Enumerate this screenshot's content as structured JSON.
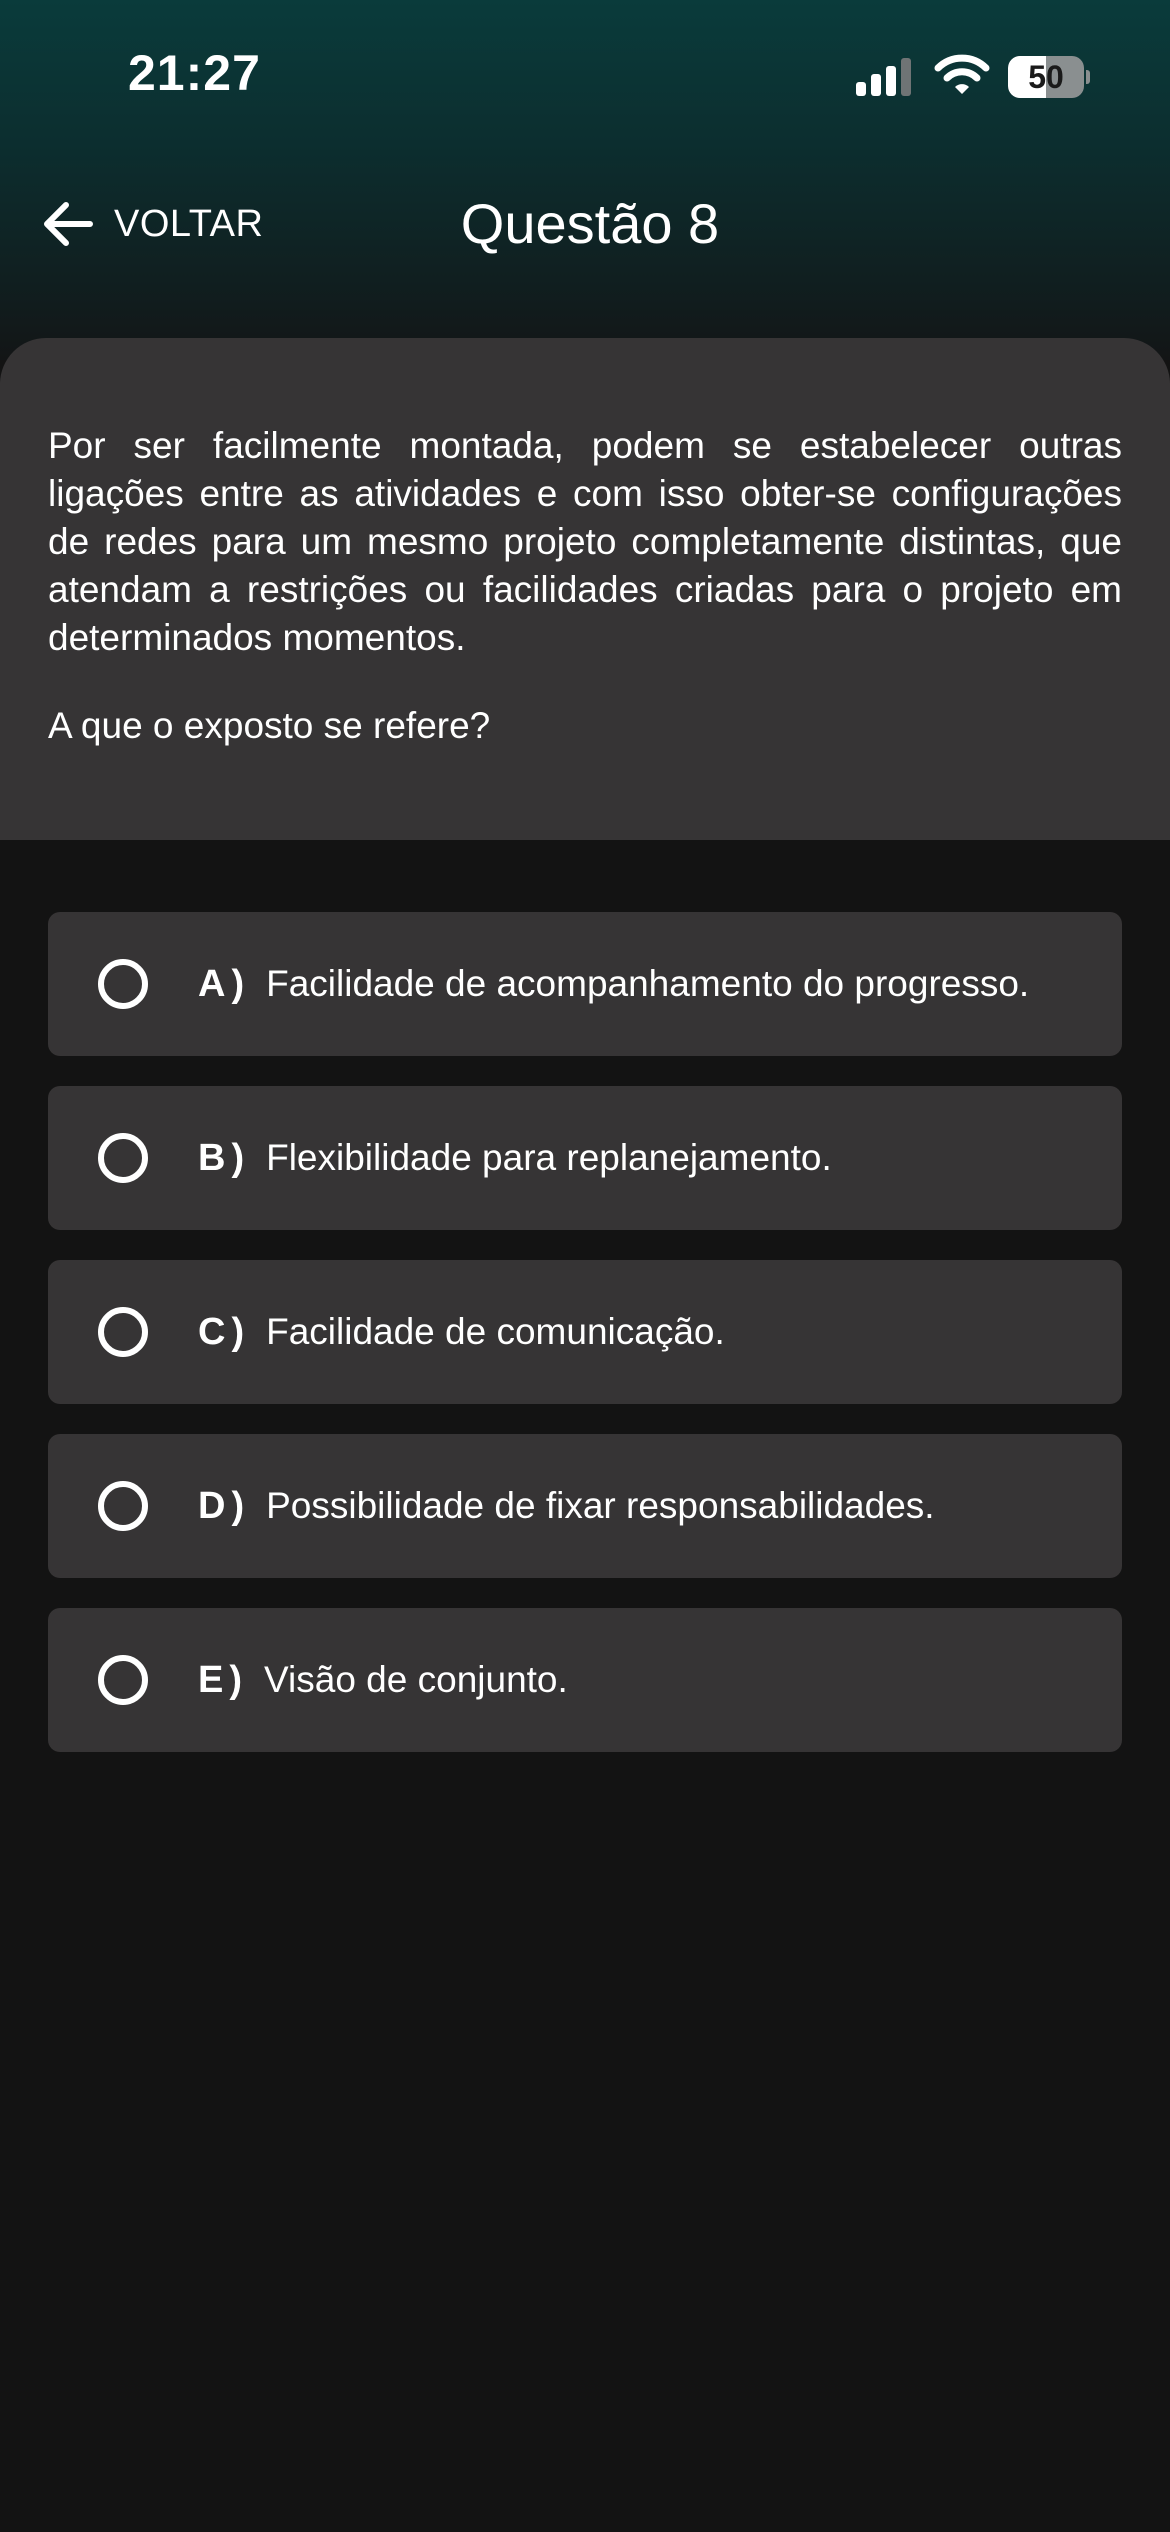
{
  "status_bar": {
    "time": "21:27",
    "battery": "50",
    "battery_level": 0.5,
    "icons": [
      "cellular-signal-icon",
      "wifi-icon",
      "battery-icon"
    ]
  },
  "nav": {
    "back_label": "VOLTAR",
    "title": "Questão 8"
  },
  "question": {
    "text": "Por ser facilmente montada, podem se estabelecer outras ligações entre as atividades e com isso obter-se configurações de redes para um mesmo projeto completamente distintas, que atendam a restrições ou facilidades criadas para o projeto em determinados momentos.",
    "prompt": "A que o exposto se refere?"
  },
  "options": [
    {
      "letter": "A",
      "paren": ")",
      "text": "Facilidade de acompanhamento do progresso."
    },
    {
      "letter": "B",
      "paren": ")",
      "text": "Flexibilidade para replanejamento."
    },
    {
      "letter": "C",
      "paren": ")",
      "text": "Facilidade de comunicação."
    },
    {
      "letter": "D",
      "paren": ")",
      "text": "Possibilidade de fixar responsabilidades."
    },
    {
      "letter": "E",
      "paren": ")",
      "text": "Visão de conjunto."
    }
  ],
  "colors": {
    "header_top": "#0a3b3b",
    "background": "#131313",
    "card": "#363435",
    "text": "#ffffff"
  }
}
